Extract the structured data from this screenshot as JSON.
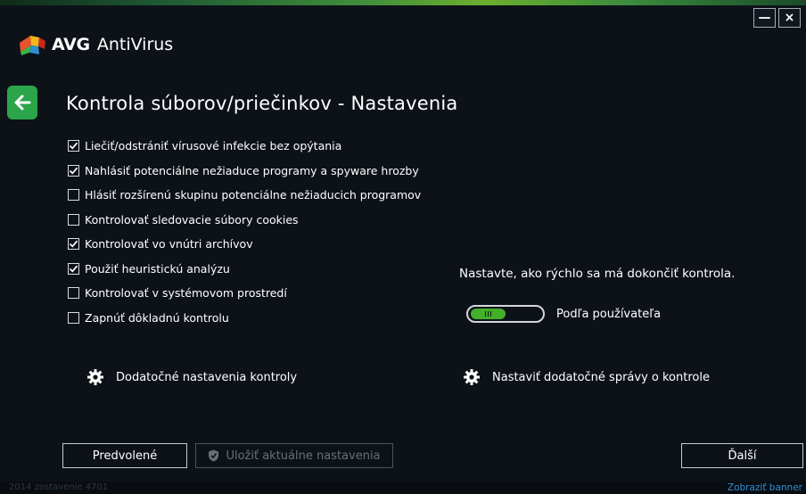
{
  "window": {
    "minimize_label": "—",
    "close_label": "×"
  },
  "brand": {
    "name": "AVG",
    "product": "AntiVirus"
  },
  "page": {
    "title": "Kontrola súborov/priečinkov - Nastavenia",
    "back_icon": "arrow-left-icon"
  },
  "options": [
    {
      "label": "Liečiť/odstrániť vírusové infekcie bez opýtania",
      "checked": true
    },
    {
      "label": "Nahlásiť potenciálne nežiaduce programy a spyware hrozby",
      "checked": true
    },
    {
      "label": "Hlásiť rozšírenú skupinu potenciálne nežiaducich programov",
      "checked": false
    },
    {
      "label": "Kontrolovať sledovacie súbory cookies",
      "checked": false
    },
    {
      "label": "Kontrolovať vo vnútri archívov",
      "checked": true
    },
    {
      "label": "Použiť heuristickú analýzu",
      "checked": true
    },
    {
      "label": "Kontrolovať v systémovom prostredí",
      "checked": false
    },
    {
      "label": "Zapnúť dôkladnú kontrolu",
      "checked": false
    }
  ],
  "speed": {
    "label": "Nastavte, ako rýchlo sa má dokončiť kontrola.",
    "value": "Podľa používateľa",
    "level": 0.5
  },
  "links": {
    "extra_scan": "Dodatočné nastavenia kontroly",
    "extra_reports": "Nastaviť dodatočné správy o kontrole"
  },
  "buttons": {
    "default": "Predvolené",
    "save": "Uložiť aktuálne nastavenia",
    "next": "Ďalší"
  },
  "footer": {
    "build": "2014 zostavenie 4701",
    "banner": "Zobraziť banner"
  },
  "colors": {
    "accent": "#2aa54a",
    "background": "#0d1219",
    "link": "#2e8fd6"
  }
}
